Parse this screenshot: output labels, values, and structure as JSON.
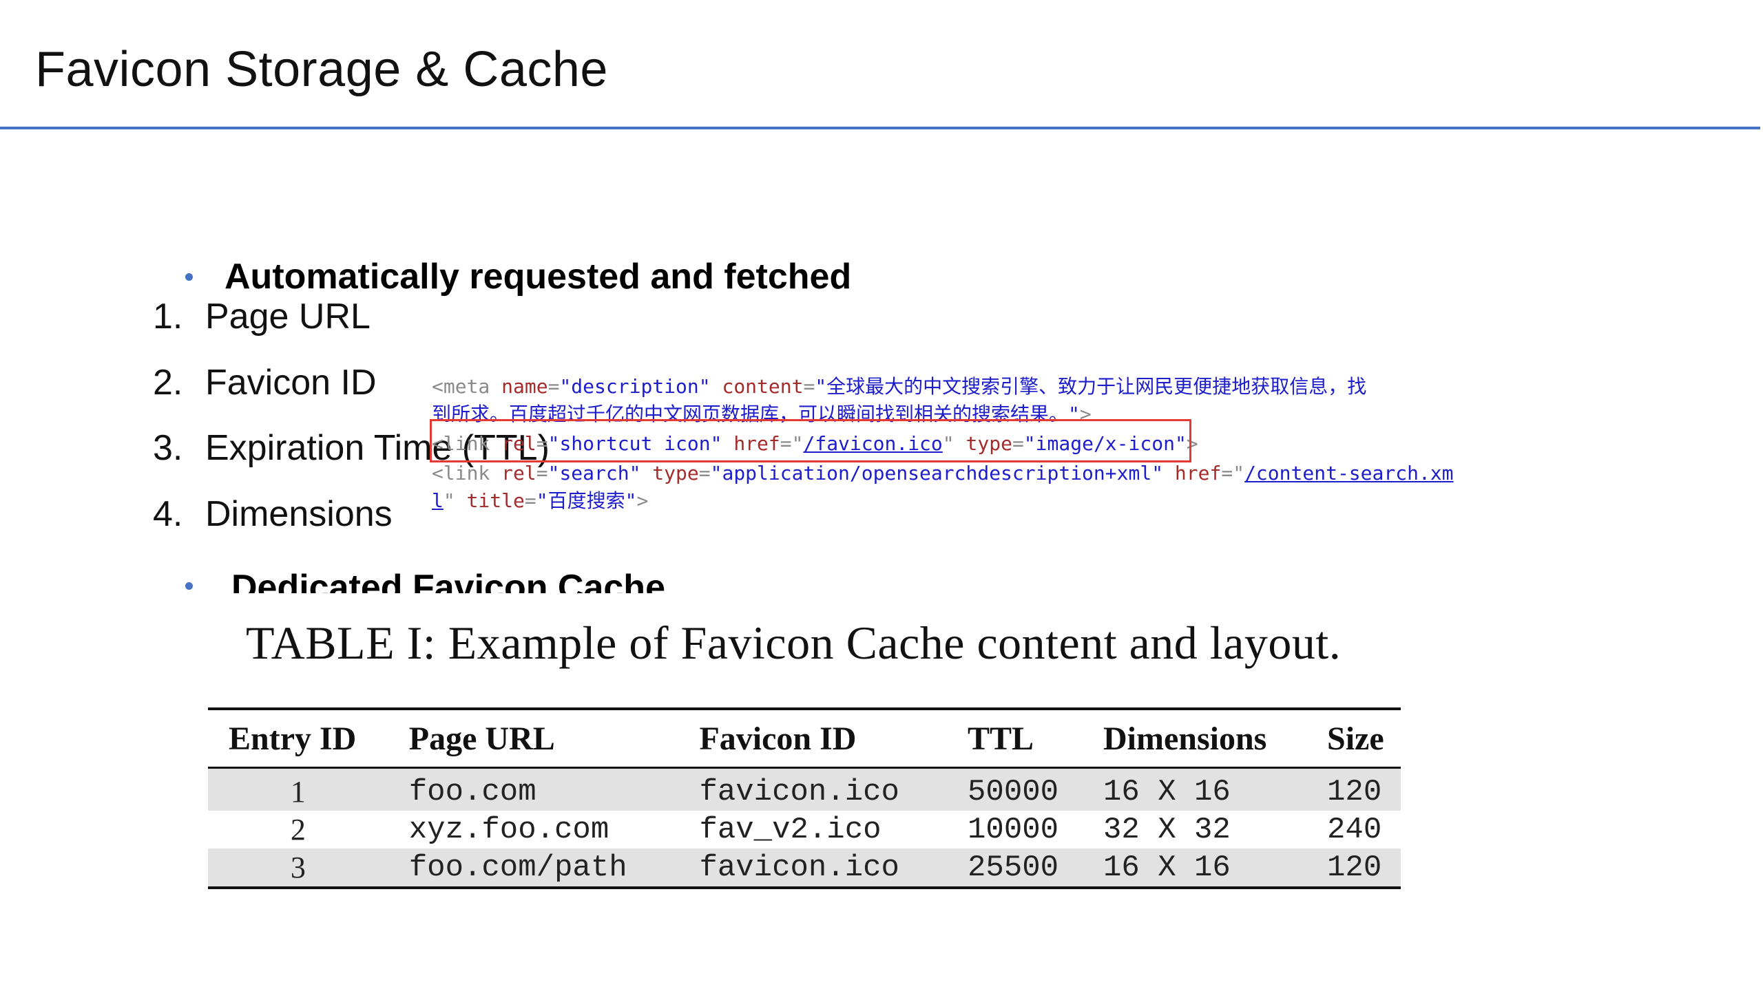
{
  "slide": {
    "title": "Favicon Storage & Cache",
    "accent_color": "#4472c4",
    "bullet1": "Automatically requested and fetched",
    "bullet2": "Dedicated Favicon Cache",
    "list": [
      {
        "num": "1.",
        "label": "Page URL"
      },
      {
        "num": "2.",
        "label": "Favicon ID"
      },
      {
        "num": "3.",
        "label": "Expiration Time (TTL)"
      },
      {
        "num": "4.",
        "label": "Dimensions"
      }
    ]
  },
  "code": {
    "line1": {
      "open": "<meta ",
      "name_attr": "name",
      "eq1": "=",
      "name_val": "\"description\"",
      "content_attr": " content",
      "eq2": "=",
      "content_val": "\"全球最大的中文搜索引擎、致力于让网民更便捷地获取信息，找"
    },
    "line2": {
      "text": "到所求。百度超过千亿的中文网页数据库，可以瞬间找到相关的搜索结果。\"",
      "close": ">"
    },
    "line3": {
      "open": "<link ",
      "rel_attr": "rel",
      "eq": "=",
      "rel_val": "\"shortcut icon\"",
      "href_attr": " href",
      "eq2": "=\"",
      "href_val": "/favicon.ico",
      "q": "\"",
      "type_attr": " type",
      "eq3": "=",
      "type_val": "\"image/x-icon\"",
      "close": ">"
    },
    "line4": {
      "open": "<link ",
      "rel_attr": "rel",
      "eq": "=",
      "rel_val": "\"search\"",
      "type_attr": " type",
      "eq2": "=",
      "type_val": "\"application/opensearchdescription+xml\"",
      "href_attr": " href",
      "eq3": "=\"",
      "href_val": "/content-search.xm"
    },
    "line5": {
      "href_rest": "l",
      "q": "\"",
      "title_attr": " title",
      "eq": "=",
      "title_val": "\"百度搜索\"",
      "close": ">"
    },
    "highlight_color": "#e53935"
  },
  "table": {
    "caption": "TABLE I: Example of Favicon Cache content and layout.",
    "headers": [
      "Entry ID",
      "Page URL",
      "Favicon ID",
      "TTL",
      "Dimensions",
      "Size"
    ],
    "rows": [
      [
        "1",
        "foo.com",
        "favicon.ico",
        "50000",
        "16 X 16",
        "120"
      ],
      [
        "2",
        "xyz.foo.com",
        "fav_v2.ico",
        "10000",
        "32 X 32",
        "240"
      ],
      [
        "3",
        "foo.com/path",
        "favicon.ico",
        "25500",
        "16 X 16",
        "120"
      ]
    ]
  }
}
